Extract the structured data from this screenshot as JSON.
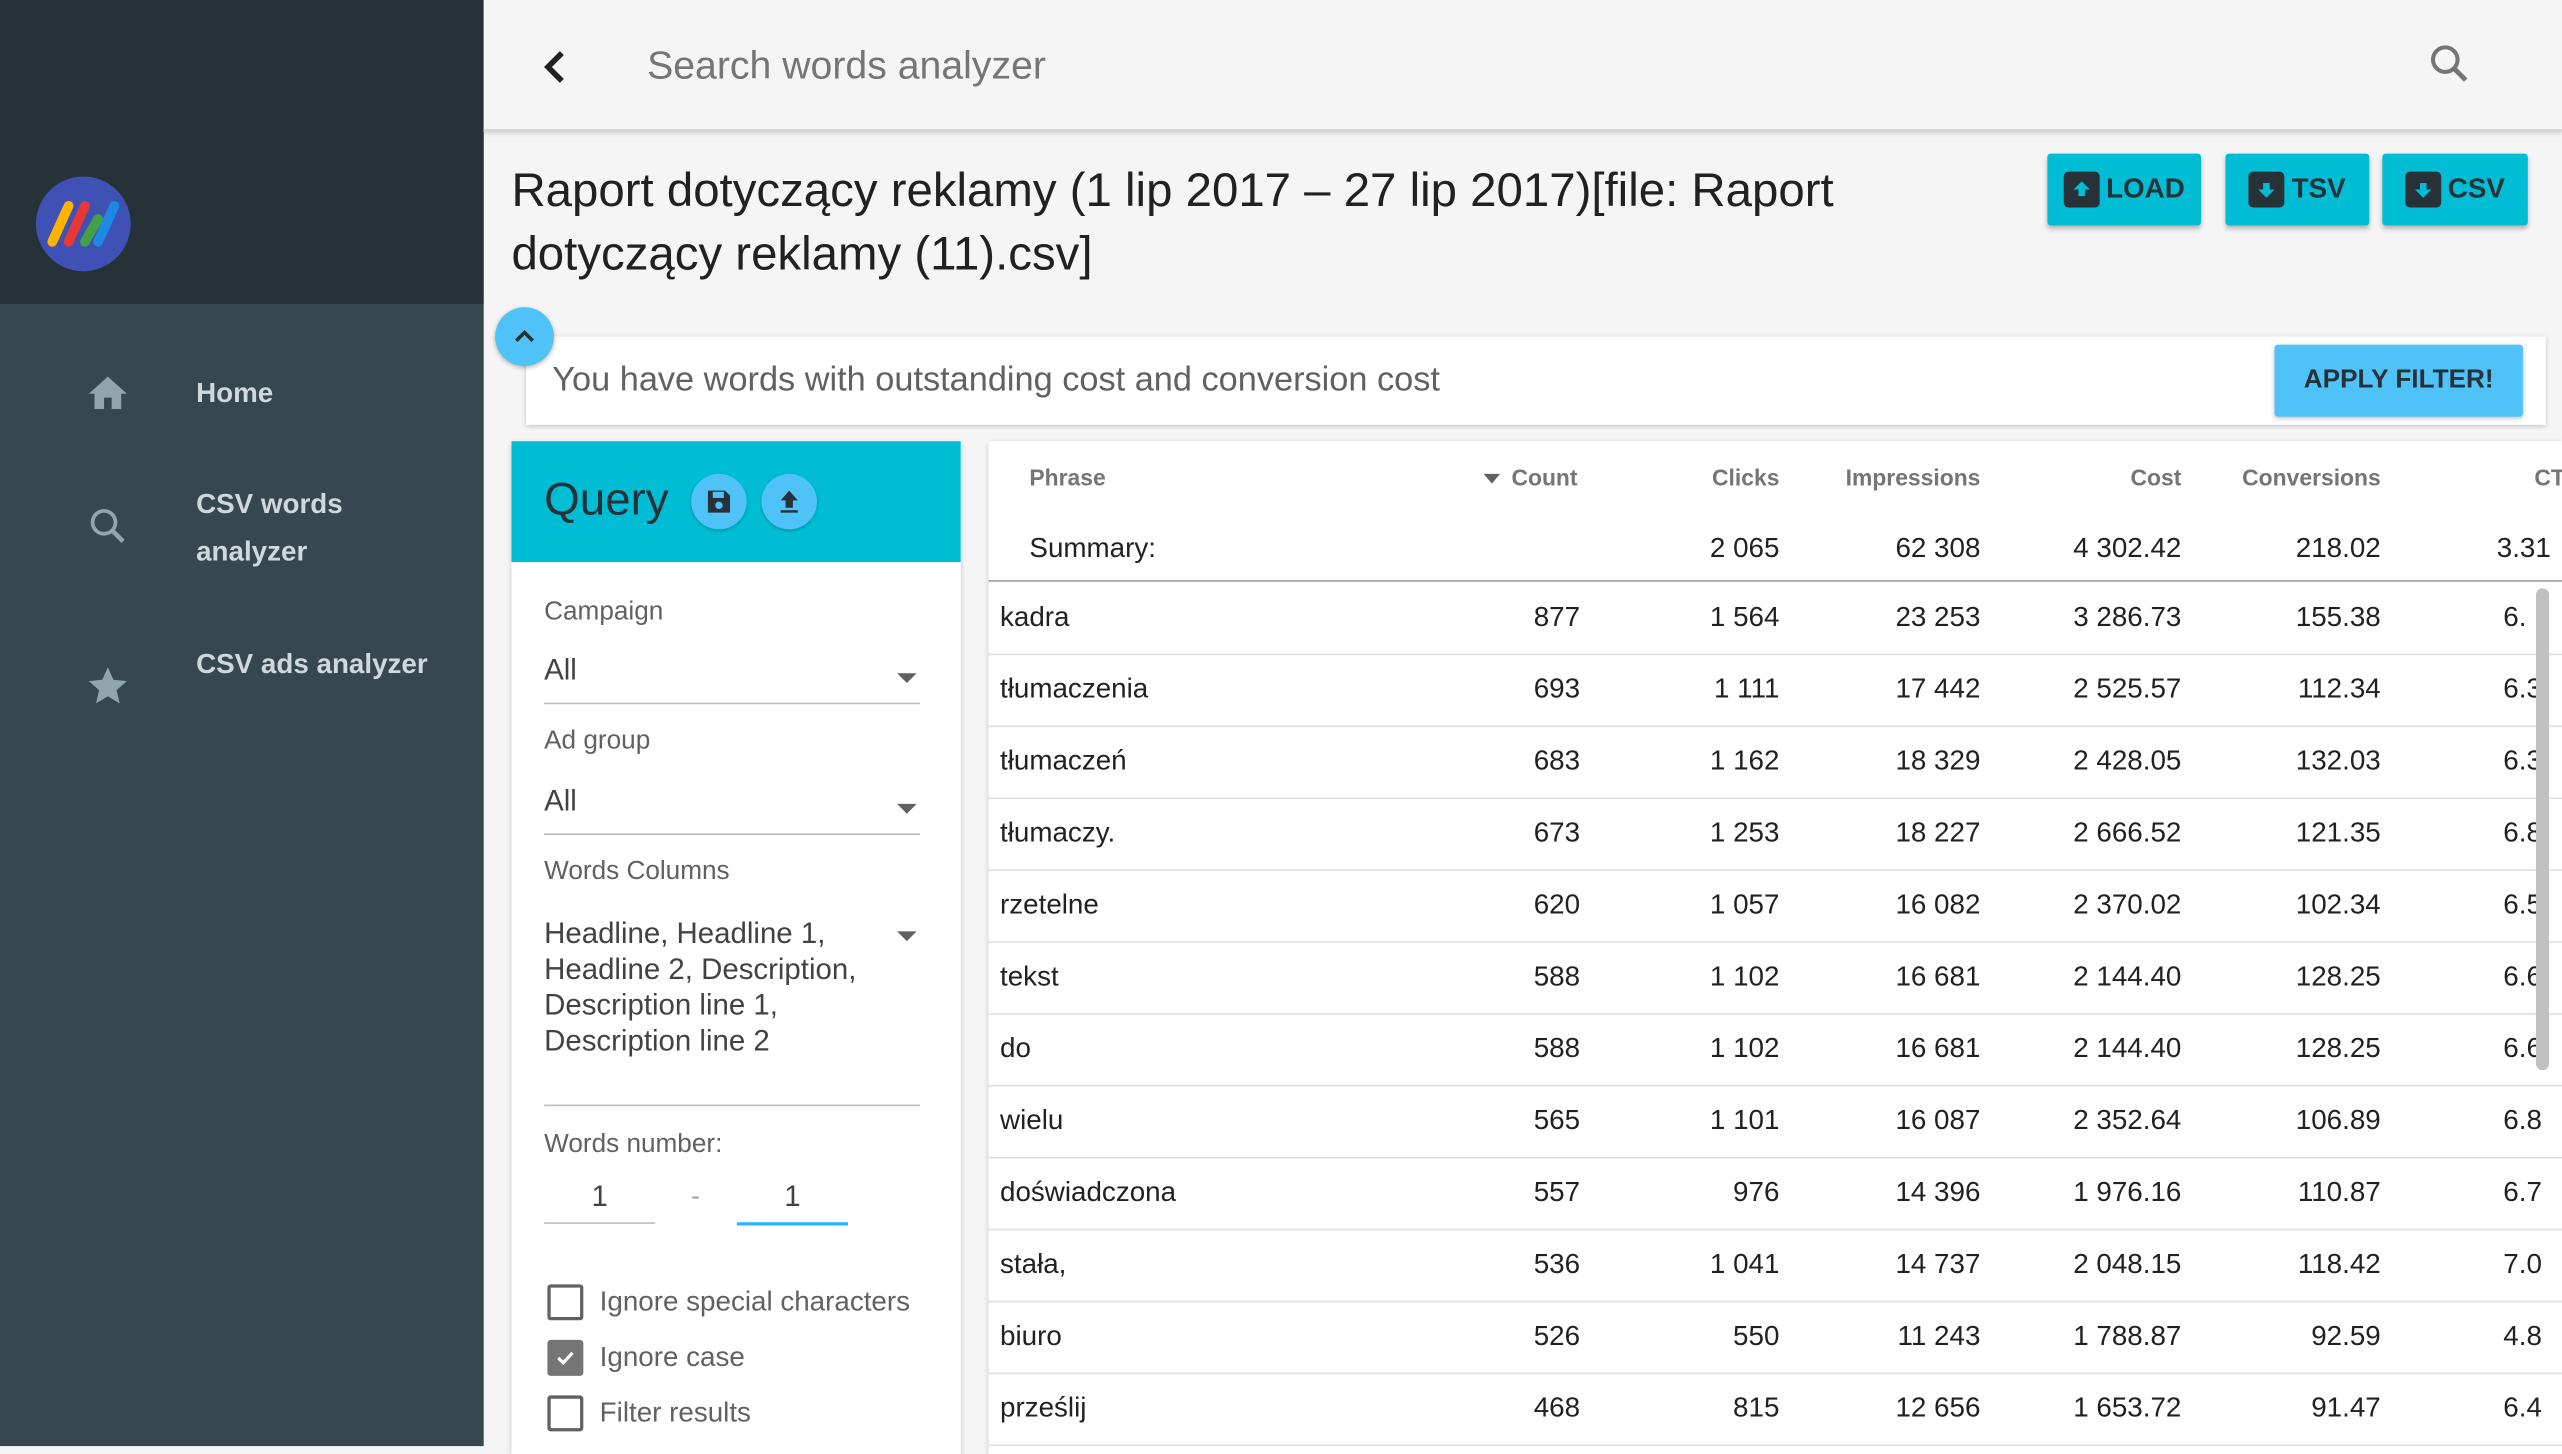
{
  "sidebar": {
    "items": [
      {
        "label": "Home",
        "icon": "home-icon"
      },
      {
        "label": "CSV words analyzer",
        "icon": "search-icon"
      },
      {
        "label": "CSV ads analyzer",
        "icon": "star-icon"
      }
    ]
  },
  "topbar": {
    "search_placeholder": "Search words analyzer"
  },
  "header": {
    "title": "Raport dotyczący reklamy (1 lip 2017 – 27 lip 2017)[file: Raport dotyczący reklamy (11).csv]",
    "buttons": {
      "load": "LOAD",
      "tsv": "TSV",
      "csv": "CSV"
    }
  },
  "filter": {
    "message": "You have words with outstanding cost and conversion cost",
    "apply_label": "APPLY FILTER!"
  },
  "query": {
    "title": "Query",
    "campaign_label": "Campaign",
    "campaign_value": "All",
    "adgroup_label": "Ad group",
    "adgroup_value": "All",
    "words_columns_label": "Words Columns",
    "words_columns_value": "Headline, Headline 1, Headline 2, Description, Description line 1, Description line 2",
    "words_number_label": "Words number:",
    "words_min": "1",
    "words_sep": "-",
    "words_max": "1",
    "checkboxes": [
      {
        "label": "Ignore special characters",
        "checked": false
      },
      {
        "label": "Ignore case",
        "checked": true
      },
      {
        "label": "Filter results",
        "checked": false
      }
    ]
  },
  "table": {
    "headers": [
      "Phrase",
      "Count",
      "Clicks",
      "Impressions",
      "Cost",
      "Conversions",
      "CT"
    ],
    "summary": {
      "label": "Summary:",
      "clicks": "2 065",
      "impressions": "62 308",
      "cost": "4 302.42",
      "conversions": "218.02",
      "ct": "3.31"
    },
    "rows": [
      {
        "phrase": "kadra",
        "count": "877",
        "clicks": "1 564",
        "impressions": "23 253",
        "cost": "3 286.73",
        "conversions": "155.38",
        "ct": "6."
      },
      {
        "phrase": "tłumaczenia",
        "count": "693",
        "clicks": "1 111",
        "impressions": "17 442",
        "cost": "2 525.57",
        "conversions": "112.34",
        "ct": "6.3"
      },
      {
        "phrase": "tłumaczeń",
        "count": "683",
        "clicks": "1 162",
        "impressions": "18 329",
        "cost": "2 428.05",
        "conversions": "132.03",
        "ct": "6.3"
      },
      {
        "phrase": "tłumaczy.",
        "count": "673",
        "clicks": "1 253",
        "impressions": "18 227",
        "cost": "2 666.52",
        "conversions": "121.35",
        "ct": "6.8"
      },
      {
        "phrase": "rzetelne",
        "count": "620",
        "clicks": "1 057",
        "impressions": "16 082",
        "cost": "2 370.02",
        "conversions": "102.34",
        "ct": "6.5"
      },
      {
        "phrase": "tekst",
        "count": "588",
        "clicks": "1 102",
        "impressions": "16 681",
        "cost": "2 144.40",
        "conversions": "128.25",
        "ct": "6.6"
      },
      {
        "phrase": "do",
        "count": "588",
        "clicks": "1 102",
        "impressions": "16 681",
        "cost": "2 144.40",
        "conversions": "128.25",
        "ct": "6.6"
      },
      {
        "phrase": "wielu",
        "count": "565",
        "clicks": "1 101",
        "impressions": "16 087",
        "cost": "2 352.64",
        "conversions": "106.89",
        "ct": "6.8"
      },
      {
        "phrase": "doświadczona",
        "count": "557",
        "clicks": "976",
        "impressions": "14 396",
        "cost": "1 976.16",
        "conversions": "110.87",
        "ct": "6.7"
      },
      {
        "phrase": "stała,",
        "count": "536",
        "clicks": "1 041",
        "impressions": "14 737",
        "cost": "2 048.15",
        "conversions": "118.42",
        "ct": "7.0"
      },
      {
        "phrase": "biuro",
        "count": "526",
        "clicks": "550",
        "impressions": "11 243",
        "cost": "1 788.87",
        "conversions": "92.59",
        "ct": "4.8"
      },
      {
        "phrase": "prześlij",
        "count": "468",
        "clicks": "815",
        "impressions": "12 656",
        "cost": "1 653.72",
        "conversions": "91.47",
        "ct": "6.4"
      }
    ]
  },
  "colors": {
    "accent": "#00bcd4",
    "light_accent": "#4fc3f7",
    "sidebar": "#37474f",
    "sidebar_dark": "#263238"
  }
}
